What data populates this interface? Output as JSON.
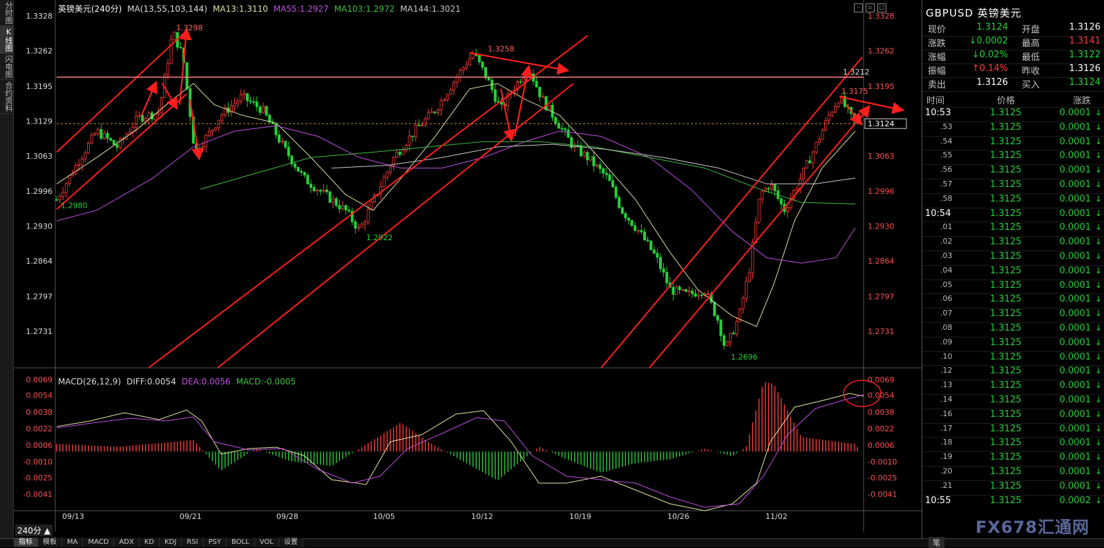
{
  "side_tabs": [
    "分时图",
    "K线图",
    "闪电图",
    "合约资料"
  ],
  "header": {
    "symbol_period": "英镑美元(240分)",
    "ma_label": "MA(13,55,103,144)",
    "ma13": "MA13:1.3110",
    "ma55": "MA55:1.2927",
    "ma103": "MA103:1.2972",
    "ma144": "MA144:1.3021"
  },
  "colors": {
    "ma13": "#e0e0a0",
    "ma55": "#c050e0",
    "ma103": "#40c040",
    "ma144": "#c8c8c8",
    "up": "#ff3b3b",
    "down": "#25d13a",
    "channel": "#ff1e1e"
  },
  "price_axis": [
    "1.3328",
    "1.3262",
    "1.3195",
    "1.3129",
    "1.3063",
    "1.2996",
    "1.2930",
    "1.2864",
    "1.2797",
    "1.2731"
  ],
  "annotations": {
    "p1": "1.3298",
    "p2": "1.3258",
    "p3": "1.3212",
    "p4": "1.3175",
    "p5": "1.2980",
    "p6": "1.2922",
    "p7": "1.2696",
    "last": "1.3124"
  },
  "macd_header": {
    "label": "MACD(26,12,9)",
    "diff": "DIFF:0.0054",
    "dea": "DEA:0.0056",
    "macd": "MACD:-0.0005"
  },
  "macd_axis": [
    "0.0069",
    "0.0054",
    "0.0038",
    "0.0022",
    "0.0006",
    "-0.0010",
    "-0.0025",
    "-0.0041"
  ],
  "dates": [
    "09/13",
    "09/21",
    "09/28",
    "10/05",
    "10/12",
    "10/19",
    "10/26",
    "11/02"
  ],
  "period_label": "240分",
  "bottom_tabs": [
    "指标",
    "模板",
    "MA",
    "MACD",
    "ADX",
    "KD",
    "KDJ",
    "RSI",
    "PSY",
    "BOLL",
    "VOL",
    "设置"
  ],
  "panel": {
    "title": "GBPUSD 英镑美元",
    "quotes": [
      {
        "l1": "现价",
        "v1": "1.3124",
        "l2": "开盘",
        "v2": "1.3126"
      },
      {
        "l1": "涨跌",
        "v1": "↓0.0002",
        "l2": "最高",
        "v2": "1.3141"
      },
      {
        "l1": "涨幅",
        "v1": "↓0.02%",
        "l2": "最低",
        "v2": "1.3122"
      },
      {
        "l1": "振幅",
        "v1": "↑0.14%",
        "l2": "昨收",
        "v2": "1.3126"
      },
      {
        "l1": "卖出",
        "v1": "1.3126",
        "l2": "买入",
        "v2": "1.3124"
      }
    ],
    "table_head": {
      "time": "时间",
      "price": "价格",
      "change": "涨跌"
    },
    "ticks": [
      {
        "t": "10:53",
        "p": "1.3125",
        "c": "0.0001"
      },
      {
        "t": ".53",
        "p": "1.3125",
        "c": "0.0001"
      },
      {
        "t": ".54",
        "p": "1.3125",
        "c": "0.0001"
      },
      {
        "t": ".55",
        "p": "1.3125",
        "c": "0.0001"
      },
      {
        "t": ".56",
        "p": "1.3125",
        "c": "0.0001"
      },
      {
        "t": ".57",
        "p": "1.3125",
        "c": "0.0001"
      },
      {
        "t": ".58",
        "p": "1.3125",
        "c": "0.0001"
      },
      {
        "t": "10:54",
        "p": "1.3125",
        "c": "0.0001"
      },
      {
        "t": ".01",
        "p": "1.3125",
        "c": "0.0001"
      },
      {
        "t": ".02",
        "p": "1.3125",
        "c": "0.0001"
      },
      {
        "t": ".03",
        "p": "1.3125",
        "c": "0.0001"
      },
      {
        "t": ".04",
        "p": "1.3125",
        "c": "0.0001"
      },
      {
        "t": ".05",
        "p": "1.3125",
        "c": "0.0001"
      },
      {
        "t": ".06",
        "p": "1.3125",
        "c": "0.0001"
      },
      {
        "t": ".07",
        "p": "1.3125",
        "c": "0.0001"
      },
      {
        "t": ".08",
        "p": "1.3125",
        "c": "0.0001"
      },
      {
        "t": ".09",
        "p": "1.3125",
        "c": "0.0001"
      },
      {
        "t": ".10",
        "p": "1.3125",
        "c": "0.0001"
      },
      {
        "t": ".12",
        "p": "1.3125",
        "c": "0.0001"
      },
      {
        "t": ".13",
        "p": "1.3125",
        "c": "0.0001"
      },
      {
        "t": ".14",
        "p": "1.3125",
        "c": "0.0001"
      },
      {
        "t": ".16",
        "p": "1.3125",
        "c": "0.0001"
      },
      {
        "t": ".17",
        "p": "1.3125",
        "c": "0.0001"
      },
      {
        "t": ".18",
        "p": "1.3125",
        "c": "0.0001"
      },
      {
        "t": ".19",
        "p": "1.3125",
        "c": "0.0001"
      },
      {
        "t": ".20",
        "p": "1.3125",
        "c": "0.0001"
      },
      {
        "t": ".21",
        "p": "1.3125",
        "c": "0.0001"
      },
      {
        "t": "10:55",
        "p": "1.3125",
        "c": "0.0002"
      }
    ],
    "note_button": "笔",
    "watermark": "FX678汇通网"
  }
}
